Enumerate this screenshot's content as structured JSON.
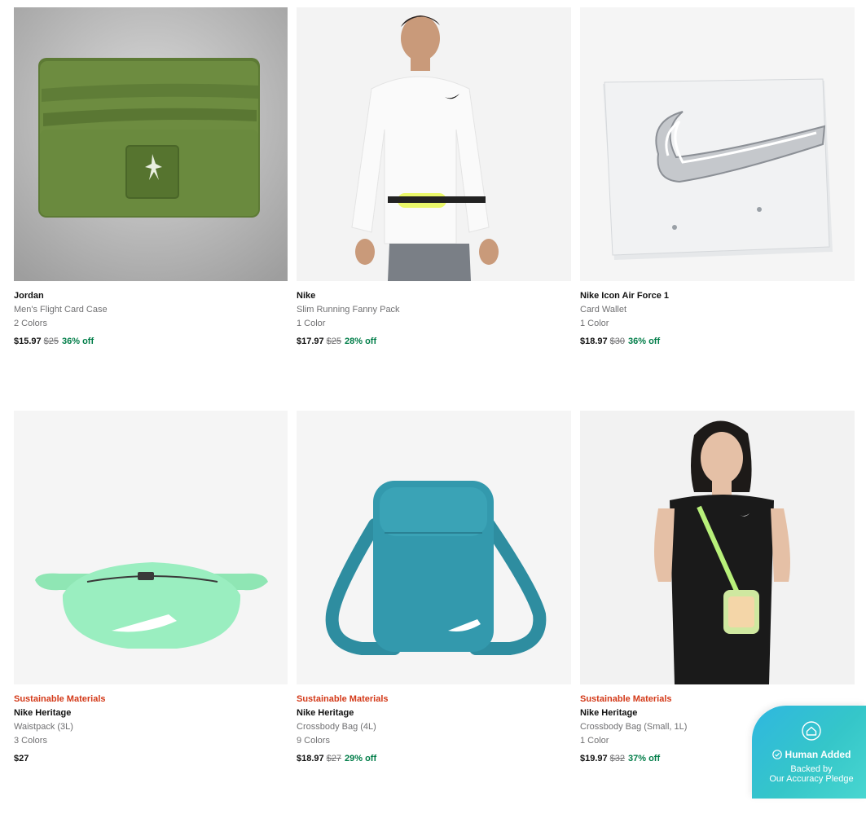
{
  "products": [
    {
      "badge": "",
      "brand": "Jordan",
      "subtitle": "Men's Flight Card Case",
      "colors": "2 Colors",
      "price": "$15.97",
      "original_price": "$25",
      "discount": "36% off",
      "image": "olive-card-case"
    },
    {
      "badge": "",
      "brand": "Nike",
      "subtitle": "Slim Running Fanny Pack",
      "colors": "1 Color",
      "price": "$17.97",
      "original_price": "$25",
      "discount": "28% off",
      "image": "runner-with-fanny-pack"
    },
    {
      "badge": "",
      "brand": "Nike Icon Air Force 1",
      "subtitle": "Card Wallet",
      "colors": "1 Color",
      "price": "$18.97",
      "original_price": "$30",
      "discount": "36% off",
      "image": "white-card-wallet-silver-swoosh"
    },
    {
      "badge": "Sustainable Materials",
      "brand": "Nike Heritage",
      "subtitle": "Waistpack (3L)",
      "colors": "3 Colors",
      "price": "$27",
      "original_price": "",
      "discount": "",
      "image": "mint-waistpack"
    },
    {
      "badge": "Sustainable Materials",
      "brand": "Nike Heritage",
      "subtitle": "Crossbody Bag (4L)",
      "colors": "9 Colors",
      "price": "$18.97",
      "original_price": "$27",
      "discount": "29% off",
      "image": "teal-crossbody-bag"
    },
    {
      "badge": "Sustainable Materials",
      "brand": "Nike Heritage",
      "subtitle": "Crossbody Bag (Small, 1L)",
      "colors": "1 Color",
      "price": "$19.97",
      "original_price": "$32",
      "discount": "37% off",
      "image": "model-with-small-crossbody"
    }
  ],
  "pledge": {
    "headline": "Human Added",
    "line1": "Backed by",
    "line2": "Our Accuracy Pledge",
    "icon": "house-outline-icon",
    "check": "check-circle-icon"
  },
  "colors": {
    "badge_red": "#d33918",
    "discount_green": "#007d48",
    "secondary_text": "#707072",
    "pledge_teal": "#35c6c9"
  }
}
